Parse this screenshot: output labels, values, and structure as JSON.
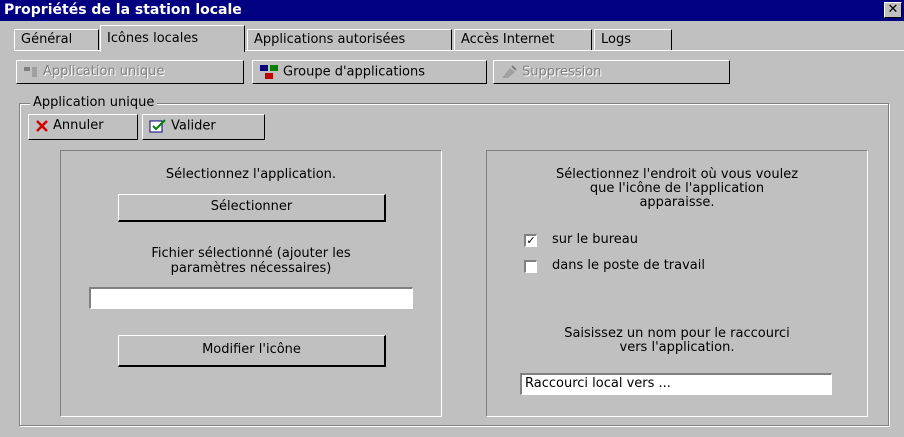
{
  "window": {
    "title": "Propriétés de la station locale",
    "close_glyph": "✕"
  },
  "tabs": [
    {
      "label": "Général"
    },
    {
      "label": "Icônes locales"
    },
    {
      "label": "Applications autorisées"
    },
    {
      "label": "Accès Internet"
    },
    {
      "label": "Logs"
    }
  ],
  "toolbar": {
    "app_unique": "Application unique",
    "groupe": "Groupe d'applications",
    "suppression": "Suppression"
  },
  "group": {
    "legend": "Application unique",
    "annuler": "Annuler",
    "valider": "Valider"
  },
  "left_panel": {
    "select_prompt": "Sélectionnez l'application.",
    "select_button": "Sélectionner",
    "file_label_1": "Fichier sélectionné (ajouter les",
    "file_label_2": "paramètres nécessaires)",
    "file_value": "",
    "modify_icon_button": "Modifier l'icône"
  },
  "right_panel": {
    "location_1": "Sélectionnez l'endroit où vous voulez",
    "location_2": "que l'icône de l'application",
    "location_3": "apparaisse.",
    "desktop_label": "sur le bureau",
    "desktop_checked": true,
    "workstation_label": "dans le poste de travail",
    "workstation_checked": false,
    "shortcut_1": "Saisissez un nom pour le raccourci",
    "shortcut_2": "vers l'application.",
    "shortcut_value": "Raccourci local vers ..."
  }
}
